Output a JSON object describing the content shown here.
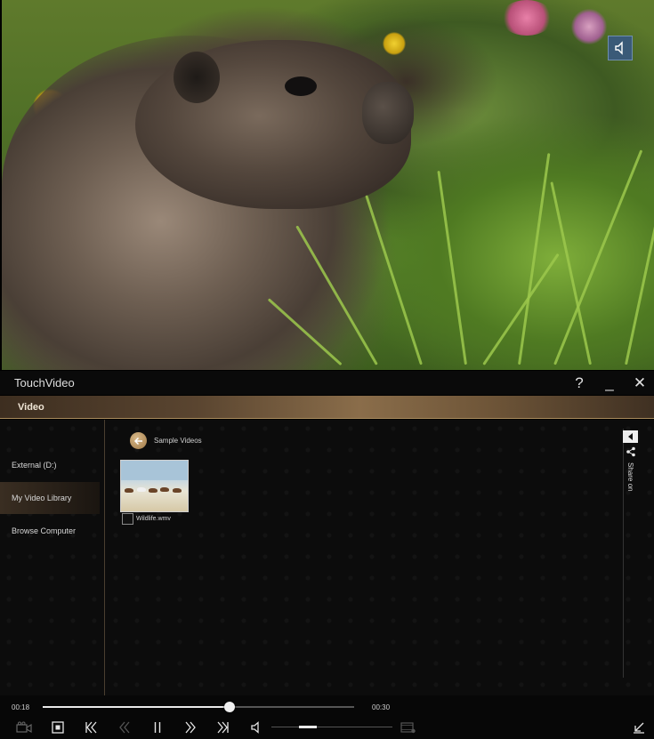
{
  "app": {
    "title": "TouchVideo",
    "help_label": "?",
    "minimize_label": "_",
    "close_label": "✕"
  },
  "section": {
    "title": "Video"
  },
  "sidebar": {
    "items": [
      {
        "label": "External (D:)",
        "active": false
      },
      {
        "label": "My Video Library",
        "active": true
      },
      {
        "label": "Browse Computer",
        "active": false
      }
    ]
  },
  "browser": {
    "breadcrumb": "Sample Videos",
    "files": [
      {
        "name": "Wildlife.wmv",
        "checked": false
      }
    ]
  },
  "share": {
    "label": "Share on"
  },
  "player": {
    "current_time": "00:18",
    "total_time": "00:30",
    "progress": 0.6,
    "volume": 0.3
  },
  "colors": {
    "accent": "#8a6d4a",
    "overlay_button": "#3a5a78"
  }
}
